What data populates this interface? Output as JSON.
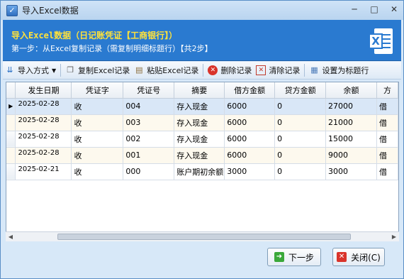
{
  "window": {
    "title": "导入Excel数据",
    "controls": {
      "minimize": "─",
      "maximize": "□",
      "close": "✕"
    }
  },
  "banner": {
    "title": "导入Excel数据（日记账凭证【工商银行】）",
    "subtitle": "第一步：从Excel复制记录（需复制明细标题行）【共2步】",
    "icon": "excel-icon",
    "icon_letter": "X"
  },
  "toolbar": {
    "import_mode": "导入方式",
    "copy_excel": "复制Excel记录",
    "paste_excel": "粘贴Excel记录",
    "delete": "删除记录",
    "clear": "清除记录",
    "set_header": "设置为标题行"
  },
  "table": {
    "columns": [
      "发生日期",
      "凭证字",
      "凭证号",
      "摘要",
      "借方金额",
      "贷方金额",
      "余额",
      "方"
    ],
    "rows": [
      {
        "date": "2025-02-28",
        "word": "收",
        "number": "004",
        "summary": "存入现金",
        "debit": "6000",
        "credit": "0",
        "balance": "27000",
        "dir": "借"
      },
      {
        "date": "2025-02-28",
        "word": "收",
        "number": "003",
        "summary": "存入现金",
        "debit": "6000",
        "credit": "0",
        "balance": "21000",
        "dir": "借"
      },
      {
        "date": "2025-02-28",
        "word": "收",
        "number": "002",
        "summary": "存入现金",
        "debit": "6000",
        "credit": "0",
        "balance": "15000",
        "dir": "借"
      },
      {
        "date": "2025-02-28",
        "word": "收",
        "number": "001",
        "summary": "存入现金",
        "debit": "6000",
        "credit": "0",
        "balance": "9000",
        "dir": "借"
      },
      {
        "date": "2025-02-21",
        "word": "收",
        "number": "000",
        "summary": "账户期初余额",
        "debit": "3000",
        "credit": "0",
        "balance": "3000",
        "dir": "借"
      }
    ],
    "selected_row_marker": "▶"
  },
  "buttons": {
    "next": "下一步",
    "close": "关闭(C)"
  },
  "colors": {
    "banner_bg": "#2a7ad0",
    "banner_title": "#ffe23a",
    "selected_row": "#d9e7f7"
  }
}
